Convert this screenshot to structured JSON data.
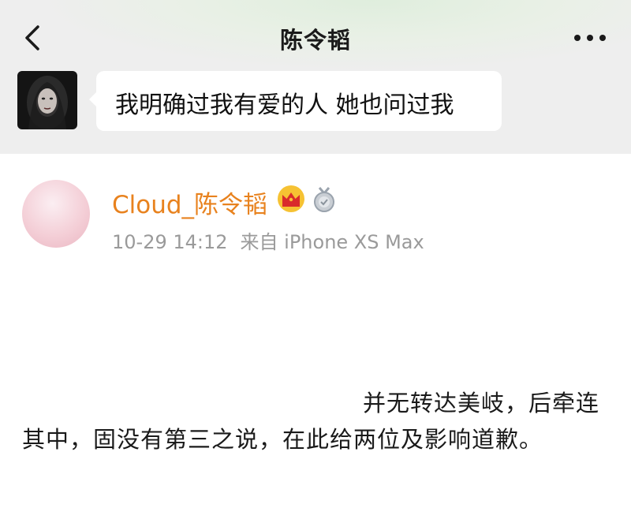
{
  "header": {
    "title": "陈令韬",
    "back_icon": "chevron-left-icon",
    "more_icon": "ellipsis-icon"
  },
  "chat": {
    "message": "我明确过我有爱的人 她也问过我"
  },
  "post": {
    "username": "Cloud_陈令韬",
    "vip_badge_icon": "crown-icon",
    "medal_icon": "medal-icon",
    "time": "10-29 14:12",
    "source": "来自 iPhone XS Max",
    "text": "并无转达美岐，后牵连其中，固没有第三之说，在此给两位及影响道歉。"
  },
  "colors": {
    "username": "#e8821e",
    "meta": "#9a9a9a",
    "chat_background": "#eeeeee"
  }
}
